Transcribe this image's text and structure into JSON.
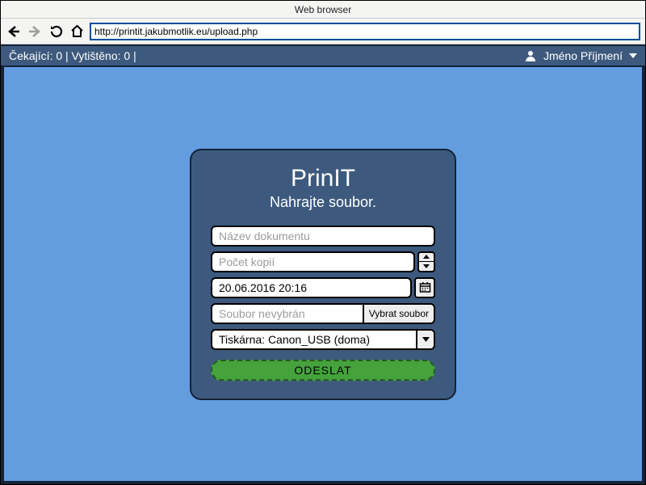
{
  "window": {
    "title": "Web browser"
  },
  "browser": {
    "url": "http://printit.jakubmotlik.eu/upload.php"
  },
  "appbar": {
    "status": "Čekající: 0 | Vytištěno: 0 |",
    "user_name": "Jméno Příjmení"
  },
  "card": {
    "title": "PrinIT",
    "subtitle": "Nahrajte soubor.",
    "doc_name_placeholder": "Název dokumentu",
    "copies_placeholder": "Počet kopií",
    "date_value": "20.06.2016 20:16",
    "file_placeholder": "Soubor nevybrán",
    "file_button": "Vybrat soubor",
    "printer_value": "Tiskárna: Canon_USB (doma)",
    "submit_label": "ODESLAT"
  }
}
